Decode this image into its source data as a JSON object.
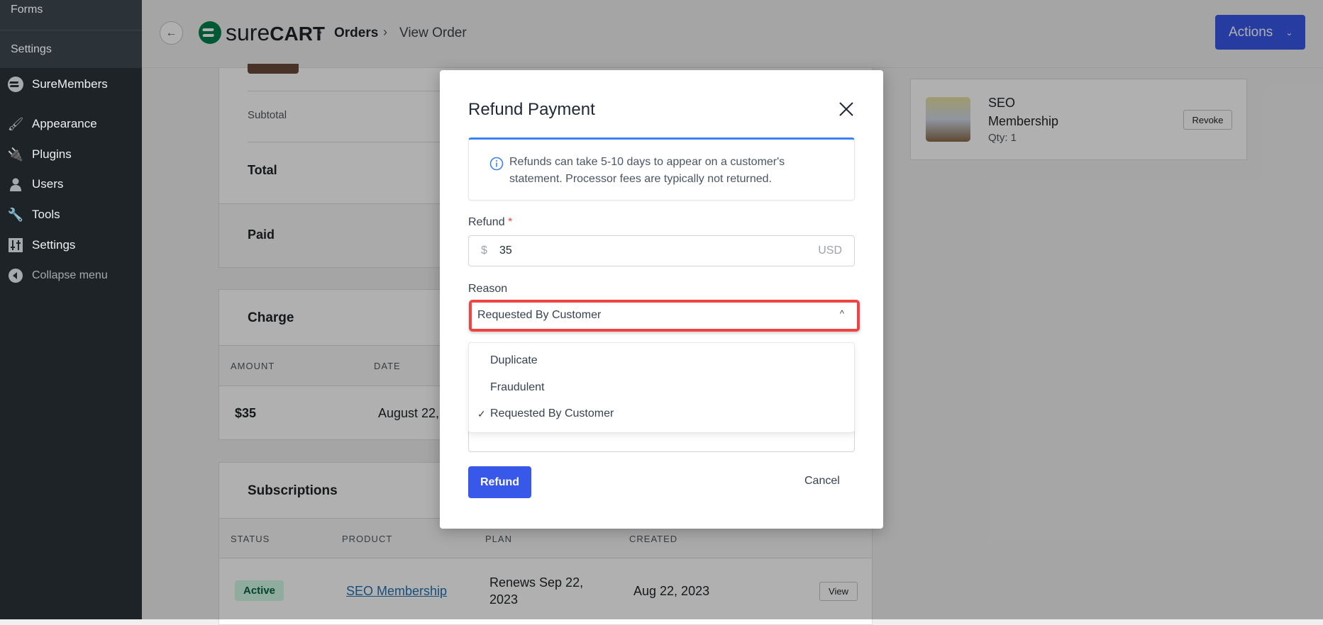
{
  "sidebar": {
    "submenu": [
      "Forms",
      "Settings"
    ],
    "items": [
      {
        "label": "SureMembers",
        "icon": "suremembers-icon"
      },
      {
        "label": "Appearance",
        "icon": "paintbrush-icon"
      },
      {
        "label": "Plugins",
        "icon": "plug-icon"
      },
      {
        "label": "Users",
        "icon": "user-icon"
      },
      {
        "label": "Tools",
        "icon": "wrench-icon"
      },
      {
        "label": "Settings",
        "icon": "sliders-icon"
      },
      {
        "label": "Collapse menu",
        "icon": "collapse-icon"
      }
    ]
  },
  "header": {
    "logo_light": "sure",
    "logo_bold": "CART",
    "breadcrumb": [
      "Orders",
      "View Order"
    ],
    "actions_label": "Actions",
    "accent": "#3858e9"
  },
  "summary": {
    "subtotal": "Subtotal",
    "total": "Total",
    "paid": "Paid"
  },
  "charge": {
    "title": "Charge",
    "columns": [
      "AMOUNT",
      "DATE"
    ],
    "row": {
      "amount": "$35",
      "date": "August 22,"
    }
  },
  "subscriptions": {
    "title": "Subscriptions",
    "columns": [
      "STATUS",
      "PRODUCT",
      "PLAN",
      "CREATED"
    ],
    "row": {
      "status": "Active",
      "product": "SEO Membership",
      "plan_line1": "Renews Sep 22,",
      "plan_line2": "2023",
      "created": "Aug 22, 2023",
      "view": "View"
    }
  },
  "purchase": {
    "name_line1": "SEO",
    "name_line2": "Membership",
    "qty": "Qty: 1",
    "revoke": "Revoke"
  },
  "modal": {
    "title": "Refund Payment",
    "info_line1": "Refunds can take 5-10 days to appear on a customer's",
    "info_line2": "statement. Processor fees are typically not returned.",
    "refund_label": "Refund",
    "required": "*",
    "currency_symbol": "$",
    "amount": "35",
    "currency": "USD",
    "reason_label": "Reason",
    "reason_selected": "Requested By Customer",
    "options": [
      "Duplicate",
      "Fraudulent",
      "Requested By Customer"
    ],
    "refund_button": "Refund",
    "cancel_button": "Cancel"
  }
}
